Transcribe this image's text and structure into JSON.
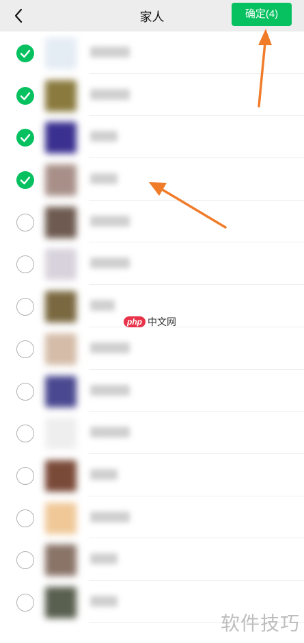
{
  "header": {
    "title": "家人",
    "confirm_label": "确定(4)"
  },
  "colors": {
    "accent": "#07c160",
    "annotation_arrow": "#f07c2a"
  },
  "contacts": [
    {
      "selected": true,
      "avatar_color": "#e4ecf4",
      "name_width": 58
    },
    {
      "selected": true,
      "avatar_color": "#8a7a3e",
      "name_width": 58
    },
    {
      "selected": true,
      "avatar_color": "#3a3090",
      "name_width": 40
    },
    {
      "selected": true,
      "avatar_color": "#a89088",
      "name_width": 40
    },
    {
      "selected": false,
      "avatar_color": "#6e5a50",
      "name_width": 58
    },
    {
      "selected": false,
      "avatar_color": "#d8d2dc",
      "name_width": 58
    },
    {
      "selected": false,
      "avatar_color": "#7a6840",
      "name_width": 36
    },
    {
      "selected": false,
      "avatar_color": "#d4bca8",
      "name_width": 58
    },
    {
      "selected": false,
      "avatar_color": "#4a4890",
      "name_width": 58
    },
    {
      "selected": false,
      "avatar_color": "#eeeeee",
      "name_width": 58
    },
    {
      "selected": false,
      "avatar_color": "#7a4a38",
      "name_width": 40
    },
    {
      "selected": false,
      "avatar_color": "#f0c898",
      "name_width": 58
    },
    {
      "selected": false,
      "avatar_color": "#8a7468",
      "name_width": 40
    },
    {
      "selected": false,
      "avatar_color": "#5a6050",
      "name_width": 40
    }
  ],
  "watermarks": {
    "php_badge": "php",
    "php_site": "中文网",
    "corner": "软件技巧"
  }
}
